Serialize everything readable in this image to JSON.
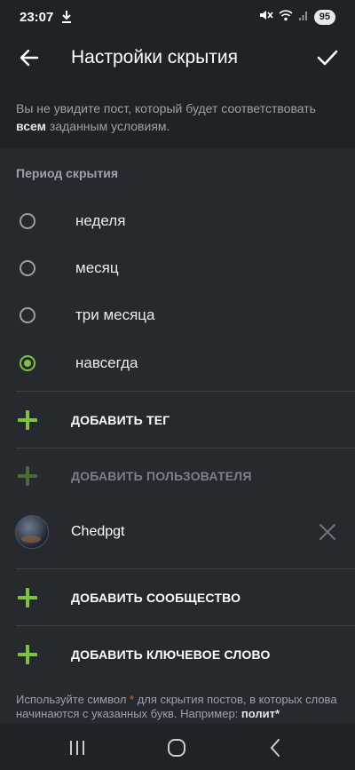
{
  "status_bar": {
    "time": "23:07",
    "battery": "95",
    "icons": [
      "download-icon",
      "mute-icon",
      "wifi-icon",
      "signal-icon"
    ]
  },
  "app_bar": {
    "title": "Настройки скрытия",
    "back_icon": "arrow-left-icon",
    "done_icon": "check-icon"
  },
  "info": {
    "before": "Вы не увидите пост, который будет соответствовать ",
    "bold": "всем",
    "after": " заданным условиям."
  },
  "period": {
    "title": "Период скрытия",
    "options": [
      {
        "label": "неделя",
        "checked": false
      },
      {
        "label": "месяц",
        "checked": false
      },
      {
        "label": "три месяца",
        "checked": false
      },
      {
        "label": "навсегда",
        "checked": true
      }
    ]
  },
  "actions": {
    "add_tag": "ДОБАВИТЬ ТЕГ",
    "add_user": "ДОБАВИТЬ ПОЛЬЗОВАТЕЛЯ",
    "add_community": "ДОБАВИТЬ СООБЩЕСТВО",
    "add_keyword": "ДОБАВИТЬ КЛЮЧЕВОЕ СЛОВО"
  },
  "user": {
    "name": "Chedpgt"
  },
  "hint": {
    "before": "Используйте символ ",
    "star": "*",
    "middle": " для скрытия постов, в которых слова начинаются с указанных букв. Например: ",
    "example": "полит*"
  },
  "colors": {
    "accent": "#7dc242",
    "background": "#262a2e",
    "bar": "#1f2326"
  }
}
